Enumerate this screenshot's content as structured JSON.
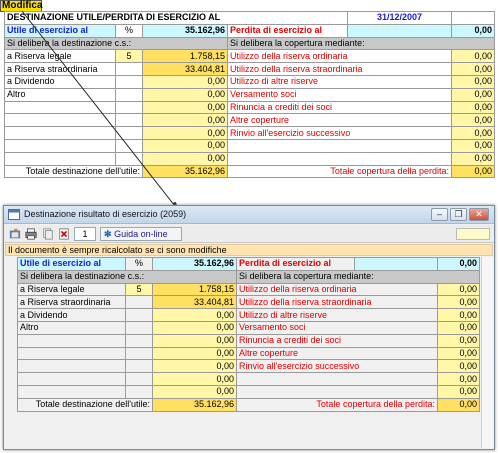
{
  "badge": {
    "label": "Modifica"
  },
  "top": {
    "header": {
      "left_title": "DESTINAZIONE UTILE/PERDITA DI ESERCIZIO AL",
      "date": "31/12/2007"
    },
    "utile_label": "Utile di esercizio al",
    "pct_label": "%",
    "utile_value": "35.162,96",
    "perdita_label": "Perdita di esercizio al",
    "perdita_value": "0,00",
    "left_sub": "Si delibera la destinazione c.s.:",
    "right_sub": "Si delibera la copertura mediante:",
    "rows": [
      {
        "l": "a Riserva legale",
        "pct": "5",
        "lv": "1.758,15",
        "r": "Utilizzo della riserva ordinaria",
        "rv": "0,00"
      },
      {
        "l": "a Riserva straordinaria",
        "pct": "",
        "lv": "33.404,81",
        "r": "Utilizzo della riserva straordinaria",
        "rv": "0,00"
      },
      {
        "l": "a Dividendo",
        "pct": "",
        "lv": "0,00",
        "r": "Utilizzo di altre riserve",
        "rv": "0,00"
      },
      {
        "l": "Altro",
        "pct": "",
        "lv": "0,00",
        "r": "Versamento soci",
        "rv": "0,00"
      },
      {
        "l": "",
        "pct": "",
        "lv": "0,00",
        "r": "Rinuncia a crediti dei soci",
        "rv": "0,00"
      },
      {
        "l": "",
        "pct": "",
        "lv": "0,00",
        "r": "Altre coperture",
        "rv": "0,00"
      },
      {
        "l": "",
        "pct": "",
        "lv": "0,00",
        "r": "Rinvio all'esercizio successivo",
        "rv": "0,00"
      },
      {
        "l": "",
        "pct": "",
        "lv": "0,00",
        "r": "",
        "rv": "0,00"
      },
      {
        "l": "",
        "pct": "",
        "lv": "0,00",
        "r": "",
        "rv": "0,00"
      }
    ],
    "total_left_label": "Totale destinazione dell'utile:",
    "total_left_value": "35.162,96",
    "total_right_label": "Totale copertura della perdita:",
    "total_right_value": "0,00"
  },
  "window": {
    "title": "Destinazione risultato di esercizio (2059)",
    "page_number": "1",
    "help_label": "Guida on-line",
    "notice": "Il documento è sempre ricalcolato se ci sono modifiche",
    "utile_label": "Utile di esercizio al",
    "pct_label": "%",
    "utile_value": "35.162,96",
    "perdita_label": "Perdita di esercizio al",
    "perdita_value": "0,00",
    "left_sub": "Si delibera la destinazione c.s.:",
    "right_sub": "Si delibera la copertura mediante:",
    "rows": [
      {
        "l": "a Riserva legale",
        "pct": "5",
        "lv": "1.758,15",
        "r": "Utilizzo della riserva ordinaria",
        "rv": "0,00"
      },
      {
        "l": "a Riserva straordinaria",
        "pct": "",
        "lv": "33.404,81",
        "r": "Utilizzo della riserva straordinaria",
        "rv": "0,00"
      },
      {
        "l": "a Dividendo",
        "pct": "",
        "lv": "0,00",
        "r": "Utilizzo di altre riserve",
        "rv": "0,00"
      },
      {
        "l": "Altro",
        "pct": "",
        "lv": "0,00",
        "r": "Versamento soci",
        "rv": "0,00"
      },
      {
        "l": "",
        "pct": "",
        "lv": "0,00",
        "r": "Rinuncia a crediti dei soci",
        "rv": "0,00"
      },
      {
        "l": "",
        "pct": "",
        "lv": "0,00",
        "r": "Altre coperture",
        "rv": "0,00"
      },
      {
        "l": "",
        "pct": "",
        "lv": "0,00",
        "r": "Rinvio all'esercizio successivo",
        "rv": "0,00"
      },
      {
        "l": "",
        "pct": "",
        "lv": "0,00",
        "r": "",
        "rv": "0,00"
      },
      {
        "l": "",
        "pct": "",
        "lv": "0,00",
        "r": "",
        "rv": "0,00"
      }
    ],
    "total_left_label": "Totale destinazione dell'utile:",
    "total_left_value": "35.162,96",
    "total_right_label": "Totale copertura della perdita:",
    "total_right_value": "0,00"
  },
  "icons": [
    "open-icon",
    "print-icon",
    "copy-icon",
    "pdf-icon",
    "help-icon",
    "minimize-icon",
    "restore-icon",
    "close-icon",
    "window-icon"
  ],
  "colors": {
    "cyan": "#ccf7ff",
    "yellow": "#ffe060",
    "light_yellow": "#fff6a8",
    "gray": "#c8c8c8",
    "red": "#e00000",
    "blue": "#1a1ad0"
  }
}
